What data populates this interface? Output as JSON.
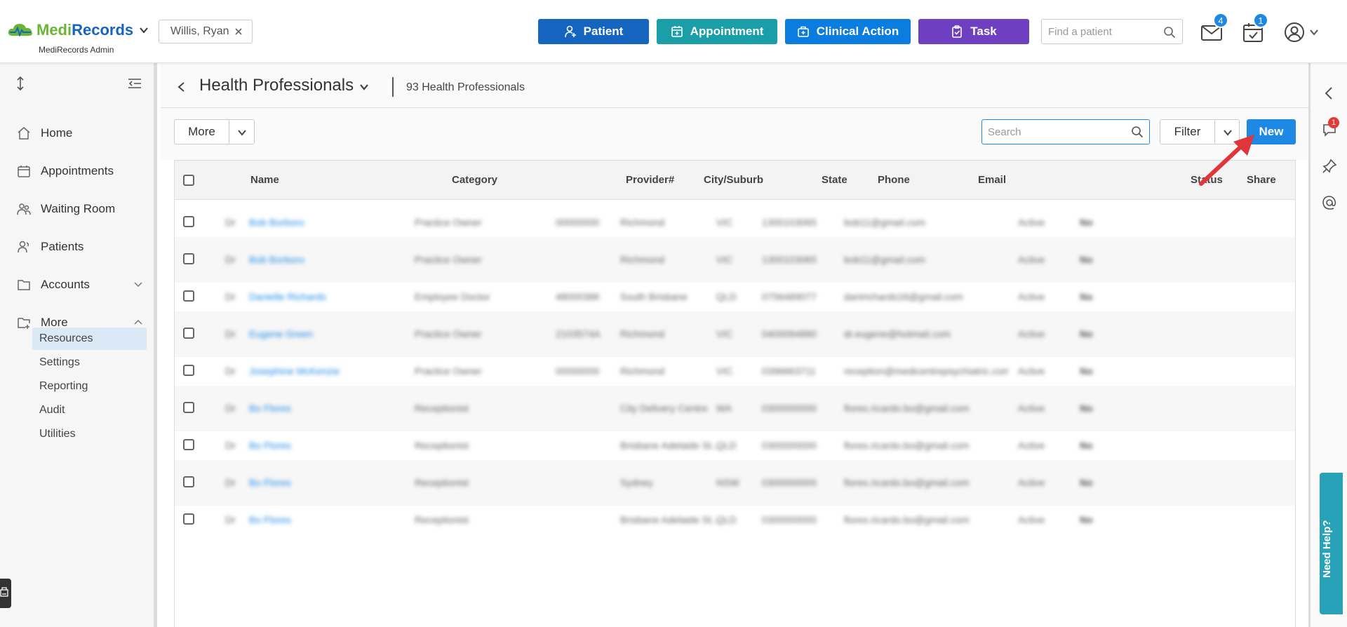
{
  "app": {
    "logo_text_a": "Medi",
    "logo_text_b": "Records",
    "logo_sub": "MediRecords Admin",
    "current_patient": "Willis, Ryan"
  },
  "topbar": {
    "patient_label": "Patient",
    "appointment_label": "Appointment",
    "clinical_label": "Clinical Action",
    "task_label": "Task",
    "find_placeholder": "Find a patient",
    "mail_count": "4",
    "tasks_count": "1",
    "colors": {
      "patient": "#1565c0",
      "appointment": "#1a9ea8",
      "clinical": "#0b7de0",
      "task": "#6f3fc1"
    }
  },
  "sidebar": {
    "items": [
      {
        "label": "Home",
        "icon": "home-icon"
      },
      {
        "label": "Appointments",
        "icon": "calendar-icon"
      },
      {
        "label": "Waiting Room",
        "icon": "people-icon"
      },
      {
        "label": "Patients",
        "icon": "person-icon"
      },
      {
        "label": "Accounts",
        "icon": "folder-icon"
      },
      {
        "label": "More",
        "icon": "folder-plus-icon"
      }
    ],
    "sub_items": [
      "Resources",
      "Settings",
      "Reporting",
      "Audit",
      "Utilities"
    ],
    "active_sub": "Resources"
  },
  "page": {
    "title": "Health Professionals",
    "count": "93 Health Professionals",
    "more_label": "More",
    "search_placeholder": "Search",
    "filter_label": "Filter",
    "new_label": "New"
  },
  "table": {
    "columns": [
      "Name",
      "Category",
      "Provider#",
      "City/Suburb",
      "State",
      "Phone",
      "Email",
      "Status",
      "Share"
    ],
    "rows": [
      {
        "col0": "Dr",
        "name": "Bob Borboro",
        "category": "Practice Owner",
        "provider": "00000000",
        "city": "Richmond",
        "state": "VIC",
        "phone": "1300103065",
        "email": "bob11@gmail.com",
        "status": "Active",
        "share": "No"
      },
      {
        "col0": "Dr",
        "name": "Bob Borboro",
        "category": "Practice Owner",
        "provider": "",
        "city": "Richmond",
        "state": "VIC",
        "phone": "1300103065",
        "email": "bob11@gmail.com",
        "status": "Active",
        "share": "No"
      },
      {
        "col0": "Dr",
        "name": "Danielle Richards",
        "category": "Employee Doctor",
        "provider": "4800038K",
        "city": "South Brisbane",
        "state": "QLD",
        "phone": "0756489077",
        "email": "danirichards16@gmail.com",
        "status": "Active",
        "share": "No"
      },
      {
        "col0": "Dr",
        "name": "Eugene Green",
        "category": "Practice Owner",
        "provider": "2103574A",
        "city": "Richmond",
        "state": "VIC",
        "phone": "0400094880",
        "email": "dr.eugene@hotmail.com",
        "status": "Active",
        "share": "No"
      },
      {
        "col0": "Dr",
        "name": "Josephine McKenzie",
        "category": "Practice Owner",
        "provider": "00000000",
        "city": "Richmond",
        "state": "VIC",
        "phone": "0396663711",
        "email": "reception@medicentrepsychiatric.com.au",
        "status": "Active",
        "share": "No"
      },
      {
        "col0": "Dr",
        "name": "Bo Flores",
        "category": "Receptionist",
        "provider": "",
        "city": "City Delivery Centre",
        "state": "WA",
        "phone": "0300000000",
        "email": "flores.ricardo.bo@gmail.com",
        "status": "Active",
        "share": "No"
      },
      {
        "col0": "Dr",
        "name": "Bo Flores",
        "category": "Receptionist",
        "provider": "",
        "city": "Brisbane Adelaide St...",
        "state": "QLD",
        "phone": "0300000000",
        "email": "flores.ricardo.bo@gmail.com",
        "status": "Active",
        "share": "No"
      },
      {
        "col0": "Dr",
        "name": "Bo Flores",
        "category": "Receptionist",
        "provider": "",
        "city": "Sydney",
        "state": "NSW",
        "phone": "0300000000",
        "email": "flores.ricardo.bo@gmail.com",
        "status": "Active",
        "share": "No"
      },
      {
        "col0": "Dr",
        "name": "Bo Flores",
        "category": "Receptionist",
        "provider": "",
        "city": "Brisbane Adelaide St...",
        "state": "QLD",
        "phone": "0300000000",
        "email": "flores.ricardo.bo@gmail.com",
        "status": "Active",
        "share": "No"
      }
    ]
  },
  "right_rail": {
    "notification_count": "1",
    "need_help_label": "Need Help?"
  }
}
